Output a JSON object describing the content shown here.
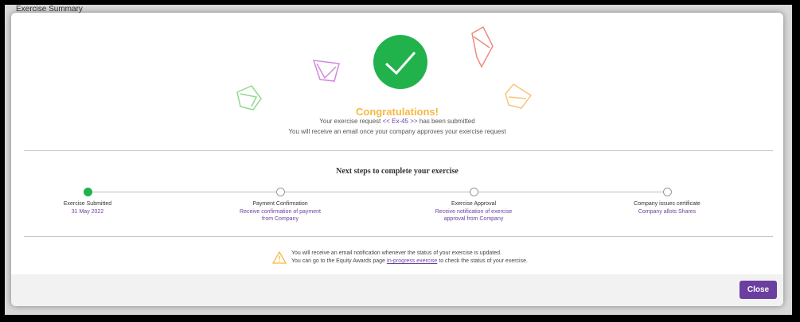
{
  "background": {
    "title": "Exercise Summary"
  },
  "icons": {
    "success": "check-icon",
    "warning": "warning-icon",
    "confetti": [
      "confetti-green-icon",
      "confetti-purple-icon",
      "confetti-red-icon",
      "confetti-orange-icon"
    ]
  },
  "colors": {
    "success": "#22b24c",
    "accent": "#6a3fa0",
    "congrats": "#f5b942",
    "warning": "#f5b942"
  },
  "header": {
    "congrats": "Congratulations!",
    "request_prefix": "Your exercise request",
    "request_id": "<< Ex-45 >>",
    "request_suffix": "has been submitted",
    "email_note": "You will receive an email once your company approves your exercise request"
  },
  "steps": {
    "title": "Next steps to complete your exercise",
    "items": [
      {
        "label": "Exercise Submitted",
        "sub": "31 May 2022",
        "done": true
      },
      {
        "label": "Payment Confirmation",
        "sub": "Receive confirmation of payment from Company",
        "done": false
      },
      {
        "label": "Exercise Approval",
        "sub": "Receive notification of exercise approval from Company",
        "done": false
      },
      {
        "label": "Company issues certificate",
        "sub": "Company allots Shares",
        "done": false
      }
    ]
  },
  "notice": {
    "line1": "You will receive an email notification whenever the status of your exercise is updated.",
    "line2_prefix": "You can go to the Equity Awards page",
    "line2_link": "In-progress exercise",
    "line2_suffix": "to check the status of your exercise."
  },
  "footer": {
    "close_label": "Close"
  }
}
